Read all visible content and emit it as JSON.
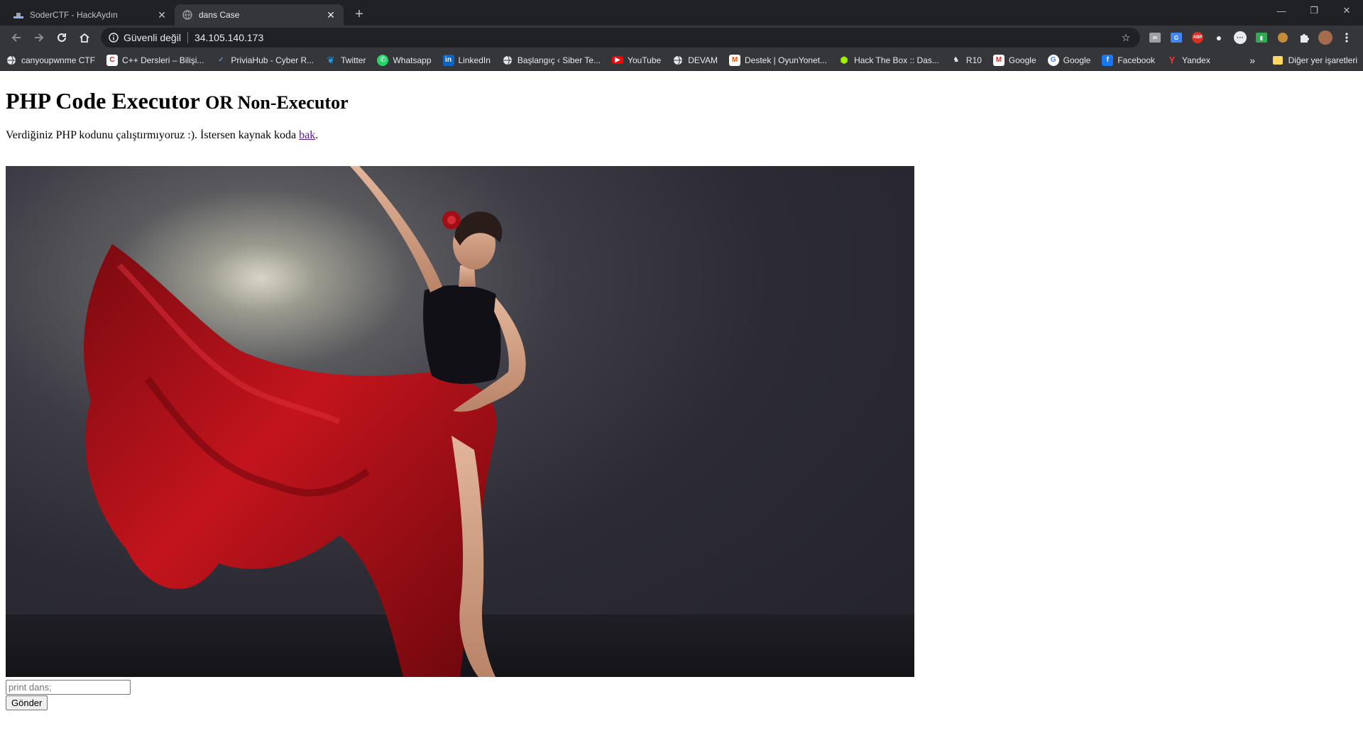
{
  "browser": {
    "tabs": [
      {
        "title": "SoderCTF - HackAydın",
        "active": false
      },
      {
        "title": "dans Case",
        "active": true
      }
    ],
    "omnibox": {
      "security_label": "Güvenli değil",
      "url": "34.105.140.173"
    },
    "bookmarks": [
      {
        "label": "canyoupwnme CTF",
        "icon": "globe-icon"
      },
      {
        "label": "C++ Dersleri – Bilişi...",
        "icon": "site-icon"
      },
      {
        "label": "PriviaHub - Cyber R...",
        "icon": "privia-icon"
      },
      {
        "label": "Twitter",
        "icon": "twitter-icon"
      },
      {
        "label": "Whatsapp",
        "icon": "whatsapp-icon"
      },
      {
        "label": "LinkedIn",
        "icon": "linkedin-icon"
      },
      {
        "label": "Başlangıç ‹ Siber Te...",
        "icon": "globe-icon"
      },
      {
        "label": "YouTube",
        "icon": "youtube-icon"
      },
      {
        "label": "DEVAM",
        "icon": "globe-icon"
      },
      {
        "label": "Destek | OyunYonet...",
        "icon": "m-icon"
      },
      {
        "label": "Hack The Box :: Das...",
        "icon": "htb-icon"
      },
      {
        "label": "R10",
        "icon": "r10-icon"
      },
      {
        "label": "Google",
        "icon": "gmail-icon"
      },
      {
        "label": "Google",
        "icon": "google-icon"
      },
      {
        "label": "Facebook",
        "icon": "facebook-icon"
      },
      {
        "label": "Yandex",
        "icon": "yandex-icon"
      }
    ],
    "bookmarks_more": "»",
    "other_bookmarks": "Diğer yer işaretleri"
  },
  "page": {
    "heading_main": "PHP Code Executor",
    "heading_small": "OR Non-Executor",
    "intro_text": "Verdiğiniz PHP kodunu çalıştırmıyoruz :). İstersen kaynak koda ",
    "intro_link": "bak",
    "intro_end": ".",
    "input_placeholder": "print dans;",
    "submit_label": "Gönder"
  },
  "colors": {
    "tabbar_bg": "#202124",
    "toolbar_bg": "#35363a",
    "link_visited": "#551a8b",
    "dress_red": "#b3121b"
  }
}
